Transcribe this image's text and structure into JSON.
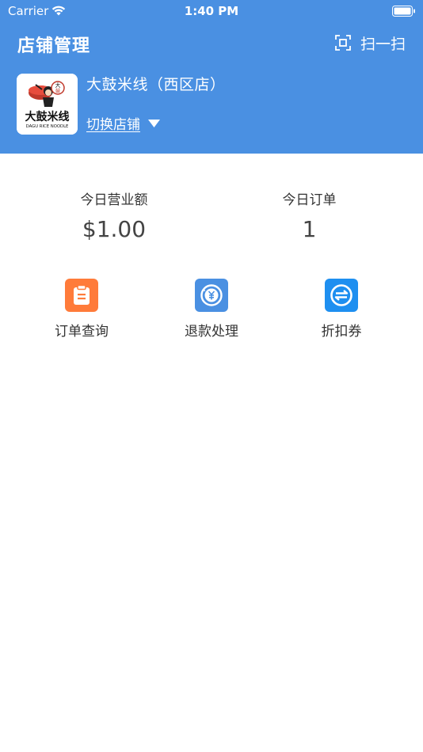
{
  "status_bar": {
    "carrier": "Carrier",
    "time": "1:40 PM"
  },
  "header": {
    "title": "店铺管理",
    "scan_label": "扫一扫",
    "store_name": "大鼓米线（西区店）",
    "switch_label": "切换店铺",
    "logo": {
      "brand_cn": "大鼓米线",
      "brand_en": "DAGU RICE NOODLE"
    }
  },
  "stats": {
    "revenue_label": "今日营业额",
    "revenue_value": "$1.00",
    "orders_label": "今日订单",
    "orders_value": "1"
  },
  "menu": [
    {
      "label": "订单查询",
      "icon": "clipboard-icon",
      "color": "#ff7b3a"
    },
    {
      "label": "退款处理",
      "icon": "refund-yen-icon",
      "color": "#4a90e2"
    },
    {
      "label": "折扣券",
      "icon": "coupon-icon",
      "color": "#1e8ff0"
    }
  ],
  "colors": {
    "header_bg": "#4a90e2",
    "text": "#333333"
  }
}
